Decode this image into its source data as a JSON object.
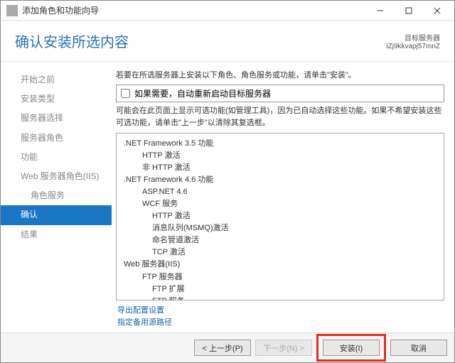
{
  "window": {
    "title": "添加角色和功能向导"
  },
  "header": {
    "heading": "确认安装所选内容",
    "target_label": "目标服务器",
    "target_value": "iZj9kkvapj57mnZ"
  },
  "sidebar": {
    "steps": [
      "开始之前",
      "安装类型",
      "服务器选择",
      "服务器角色",
      "功能",
      "Web 服务器角色(IIS)",
      "角色服务",
      "确认",
      "结果"
    ]
  },
  "main": {
    "intro": "若要在所选服务器上安装以下角色、角色服务或功能，请单击\"安装\"。",
    "auto_restart_label": "如果需要，自动重新启动目标服务器",
    "note": "可能会在此页面上显示可选功能(如管理工具)，因为已自动选择这些功能。如果不希望安装这些可选功能，请单击\"上一步\"以清除其复选框。"
  },
  "features": [
    {
      "lvl": 0,
      "text": ".NET Framework 3.5 功能"
    },
    {
      "lvl": 1,
      "text": "HTTP 激活"
    },
    {
      "lvl": 1,
      "text": "非 HTTP 激活"
    },
    {
      "lvl": 0,
      "text": ".NET Framework 4.6 功能"
    },
    {
      "lvl": 1,
      "text": "ASP.NET 4.6"
    },
    {
      "lvl": 1,
      "text": "WCF 服务"
    },
    {
      "lvl": 2,
      "text": "HTTP 激活"
    },
    {
      "lvl": 2,
      "text": "消息队列(MSMQ)激活"
    },
    {
      "lvl": 2,
      "text": "命名管道激活"
    },
    {
      "lvl": 2,
      "text": "TCP 激活"
    },
    {
      "lvl": 0,
      "text": ""
    },
    {
      "lvl": 0,
      "text": "Web 服务器(IIS)"
    },
    {
      "lvl": 1,
      "text": "FTP 服务器"
    },
    {
      "lvl": 2,
      "text": "FTP 扩展"
    },
    {
      "lvl": 2,
      "text": "FTP 服务"
    }
  ],
  "links": {
    "export": "导出配置设置",
    "alt_source": "指定备用源路径"
  },
  "footer": {
    "prev": "< 上一步(P)",
    "next": "下一步(N) >",
    "install": "安装(I)",
    "cancel": "取消"
  }
}
